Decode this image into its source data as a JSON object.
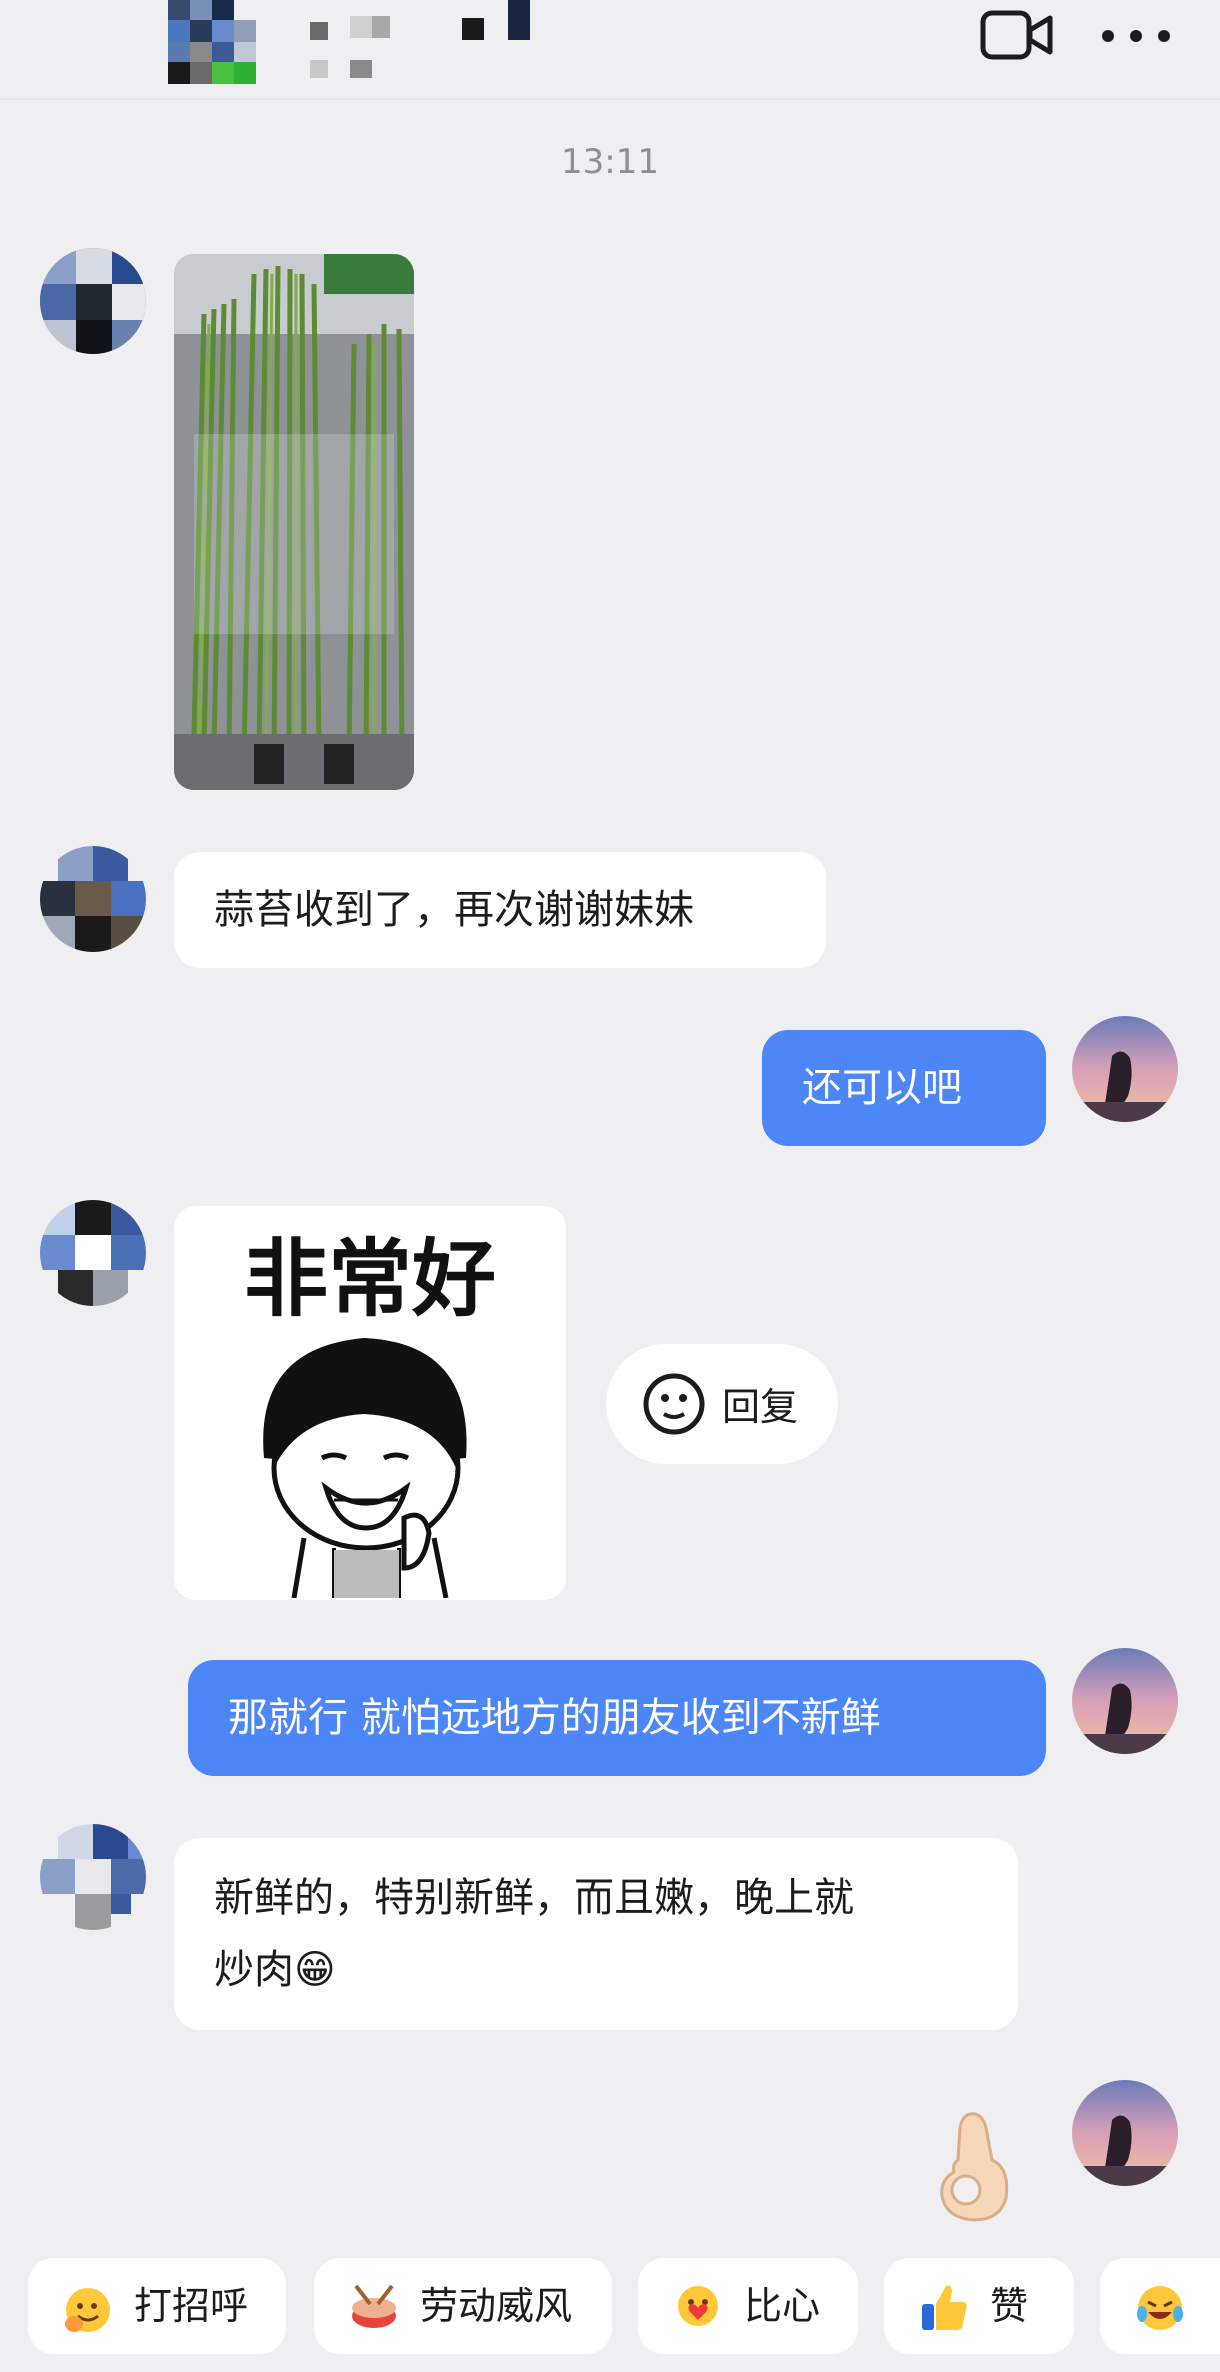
{
  "timestamp": "13:11",
  "messages": {
    "m2": "蒜苔收到了，再次谢谢妹妹",
    "m3": "还可以吧",
    "sticker_text": "非常好",
    "m5": "那就行 就怕远地方的朋友收到不新鲜",
    "m6_line1": "新鲜的，特别新鲜，而且嫩，晚上就",
    "m6_line2": "炒肉😁"
  },
  "reply_chip": {
    "label": "回复"
  },
  "quick_replies": [
    {
      "label": "打招呼",
      "icon": "wave-emoji-icon"
    },
    {
      "label": "劳动威风",
      "icon": "drum-emoji-icon"
    },
    {
      "label": "比心",
      "icon": "heart-hand-emoji-icon"
    },
    {
      "label": "赞",
      "icon": "thumbs-up-emoji-icon"
    },
    {
      "label": "",
      "icon": "laughing-emoji-icon"
    }
  ],
  "colors": {
    "background": "#efeff1",
    "outgoing_bubble": "#4d86f7",
    "incoming_bubble": "#ffffff",
    "timestamp": "#8e8e93"
  }
}
